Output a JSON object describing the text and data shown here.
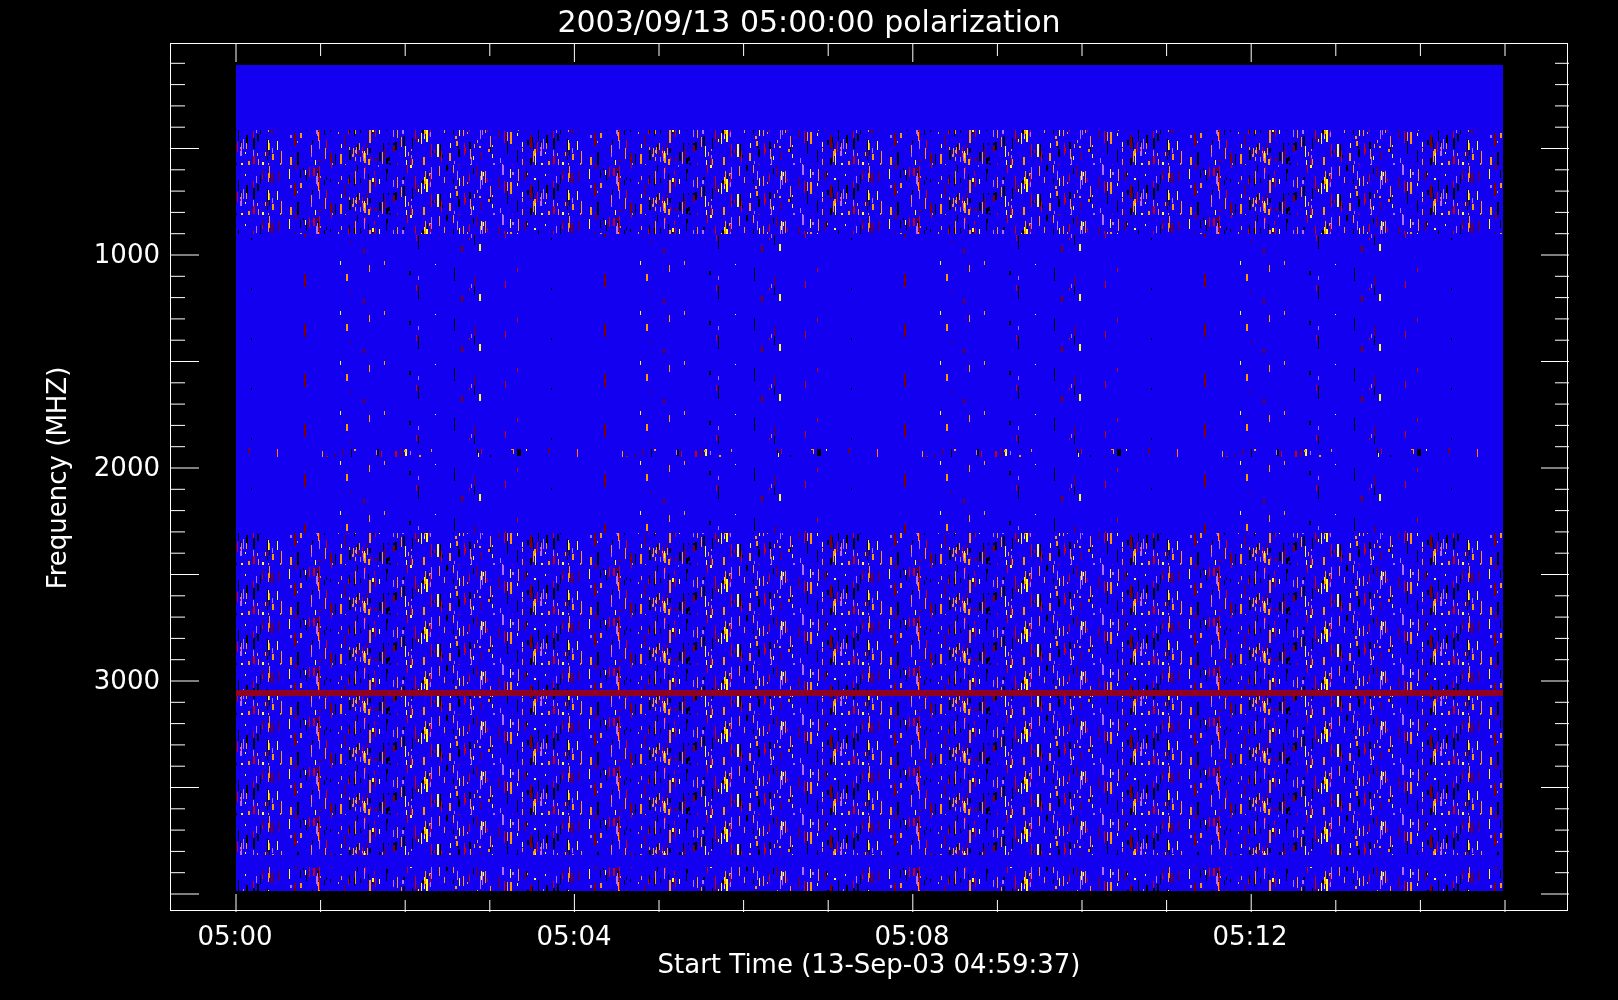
{
  "title": "2003/09/13 05:00:00 polarization",
  "plot": {
    "ylabel": "Frequency (MHZ)",
    "xlabel": "Start Time (13-Sep-03 04:59:37)",
    "yticks": [
      "1000",
      "2000",
      "3000"
    ],
    "xticks": [
      "05:00",
      "05:04",
      "05:08",
      "05:12"
    ]
  }
}
